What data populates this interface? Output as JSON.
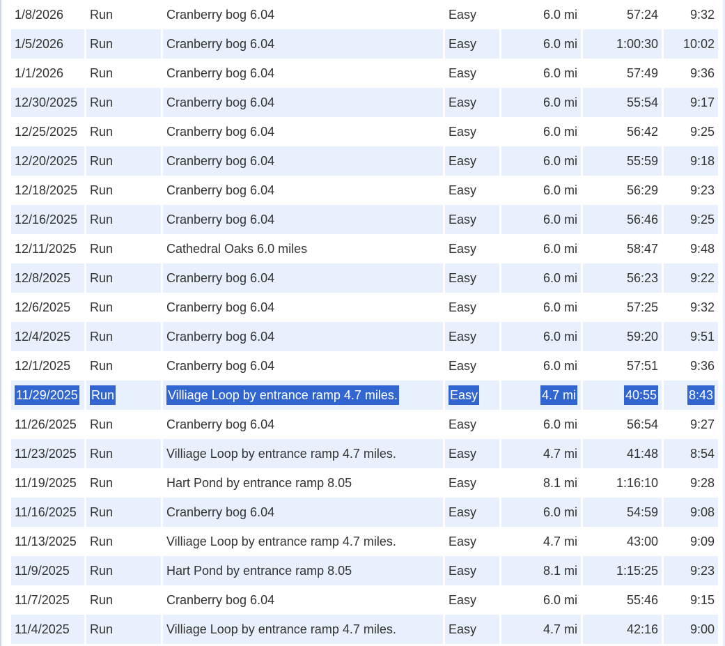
{
  "activity_log": {
    "rows": [
      {
        "date": "1/8/2026",
        "type": "Run",
        "route": "Cranberry bog 6.04",
        "effort": "Easy",
        "distance": "6.0 mi",
        "time": "57:24",
        "pace": "9:32"
      },
      {
        "date": "1/5/2026",
        "type": "Run",
        "route": "Cranberry bog 6.04",
        "effort": "Easy",
        "distance": "6.0 mi",
        "time": "1:00:30",
        "pace": "10:02"
      },
      {
        "date": "1/1/2026",
        "type": "Run",
        "route": "Cranberry bog 6.04",
        "effort": "Easy",
        "distance": "6.0 mi",
        "time": "57:49",
        "pace": "9:36"
      },
      {
        "date": "12/30/2025",
        "type": "Run",
        "route": "Cranberry bog 6.04",
        "effort": "Easy",
        "distance": "6.0 mi",
        "time": "55:54",
        "pace": "9:17"
      },
      {
        "date": "12/25/2025",
        "type": "Run",
        "route": "Cranberry bog 6.04",
        "effort": "Easy",
        "distance": "6.0 mi",
        "time": "56:42",
        "pace": "9:25"
      },
      {
        "date": "12/20/2025",
        "type": "Run",
        "route": "Cranberry bog 6.04",
        "effort": "Easy",
        "distance": "6.0 mi",
        "time": "55:59",
        "pace": "9:18"
      },
      {
        "date": "12/18/2025",
        "type": "Run",
        "route": "Cranberry bog 6.04",
        "effort": "Easy",
        "distance": "6.0 mi",
        "time": "56:29",
        "pace": "9:23"
      },
      {
        "date": "12/16/2025",
        "type": "Run",
        "route": "Cranberry bog 6.04",
        "effort": "Easy",
        "distance": "6.0 mi",
        "time": "56:46",
        "pace": "9:25"
      },
      {
        "date": "12/11/2025",
        "type": "Run",
        "route": "Cathedral Oaks 6.0 miles",
        "effort": "Easy",
        "distance": "6.0 mi",
        "time": "58:47",
        "pace": "9:48"
      },
      {
        "date": "12/8/2025",
        "type": "Run",
        "route": "Cranberry bog 6.04",
        "effort": "Easy",
        "distance": "6.0 mi",
        "time": "56:23",
        "pace": "9:22"
      },
      {
        "date": "12/6/2025",
        "type": "Run",
        "route": "Cranberry bog 6.04",
        "effort": "Easy",
        "distance": "6.0 mi",
        "time": "57:25",
        "pace": "9:32"
      },
      {
        "date": "12/4/2025",
        "type": "Run",
        "route": "Cranberry bog 6.04",
        "effort": "Easy",
        "distance": "6.0 mi",
        "time": "59:20",
        "pace": "9:51"
      },
      {
        "date": "12/1/2025",
        "type": "Run",
        "route": "Cranberry bog 6.04",
        "effort": "Easy",
        "distance": "6.0 mi",
        "time": "57:51",
        "pace": "9:36"
      },
      {
        "date": "11/29/2025",
        "type": "Run",
        "route": "Villiage Loop by entrance ramp 4.7 miles.",
        "effort": "Easy",
        "distance": "4.7 mi",
        "time": "40:55",
        "pace": "8:43"
      },
      {
        "date": "11/26/2025",
        "type": "Run",
        "route": "Cranberry bog 6.04",
        "effort": "Easy",
        "distance": "6.0 mi",
        "time": "56:54",
        "pace": "9:27"
      },
      {
        "date": "11/23/2025",
        "type": "Run",
        "route": "Villiage Loop by entrance ramp 4.7 miles.",
        "effort": "Easy",
        "distance": "4.7 mi",
        "time": "41:48",
        "pace": "8:54"
      },
      {
        "date": "11/19/2025",
        "type": "Run",
        "route": "Hart Pond by entrance ramp 8.05",
        "effort": "Easy",
        "distance": "8.1 mi",
        "time": "1:16:10",
        "pace": "9:28"
      },
      {
        "date": "11/16/2025",
        "type": "Run",
        "route": "Cranberry bog 6.04",
        "effort": "Easy",
        "distance": "6.0 mi",
        "time": "54:59",
        "pace": "9:08"
      },
      {
        "date": "11/13/2025",
        "type": "Run",
        "route": "Villiage Loop by entrance ramp 4.7 miles.",
        "effort": "Easy",
        "distance": "4.7 mi",
        "time": "43:00",
        "pace": "9:09"
      },
      {
        "date": "11/9/2025",
        "type": "Run",
        "route": "Hart Pond by entrance ramp 8.05",
        "effort": "Easy",
        "distance": "8.1 mi",
        "time": "1:15:25",
        "pace": "9:23"
      },
      {
        "date": "11/7/2025",
        "type": "Run",
        "route": "Cranberry bog 6.04",
        "effort": "Easy",
        "distance": "6.0 mi",
        "time": "55:46",
        "pace": "9:15"
      },
      {
        "date": "11/4/2025",
        "type": "Run",
        "route": "Villiage Loop by entrance ramp 4.7 miles.",
        "effort": "Easy",
        "distance": "4.7 mi",
        "time": "42:16",
        "pace": "9:00"
      }
    ],
    "selected_row_index": 13
  },
  "colors": {
    "row_alt_background": "#e8f0fd",
    "selection_background": "#3166d1",
    "selection_text": "#ffffff",
    "text": "#333333"
  }
}
